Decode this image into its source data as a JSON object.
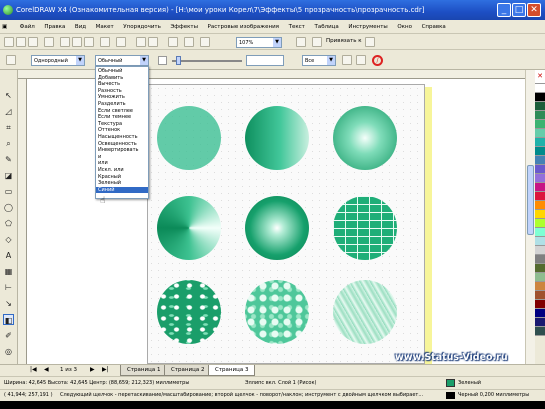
{
  "window": {
    "title": "CorelDRAW X4 (Ознакомительная версия) - [H:\\мои уроки Корел\\7\\Эффекты\\5 прозрачность\\прозрачность.cdr]",
    "buttons": {
      "minimize": "_",
      "maximize": "□",
      "close": "✕"
    }
  },
  "menu": {
    "items": [
      "Файл",
      "Правка",
      "Вид",
      "Макет",
      "Упорядочить",
      "Эффекты",
      "Растровые изображения",
      "Текст",
      "Таблица",
      "Инструменты",
      "Окно",
      "Справка"
    ],
    "window_controls": [
      "_",
      "□",
      "✕"
    ]
  },
  "toolbar1": {
    "zoom_value": "107%",
    "snap_label": "Привязать к"
  },
  "toolbar2": {
    "transparency_mode": "Однородный",
    "merge_mode": "Обычный",
    "apply_to": "Все"
  },
  "merge_mode_options": [
    "Обычный",
    "Добавить",
    "Вычесть",
    "Разность",
    "Умножить",
    "Разделить",
    "Если светлее",
    "Если темнее",
    "Текстура",
    "Оттенок",
    "Насыщенность",
    "Освещенность",
    "Инвертировать",
    "и",
    "или",
    "Искл. или",
    "Красный",
    "Зеленый",
    "Синий"
  ],
  "merge_mode_selected_index": 18,
  "colors": {
    "accent": "#1a9e6a",
    "page_border": "#f7f59a",
    "palette": [
      "#ffffff",
      "#000000",
      "#1b5e3a",
      "#2e8b57",
      "#3cb371",
      "#66cdaa",
      "#20b2aa",
      "#008b8b",
      "#4682b4",
      "#6a5acd",
      "#9370db",
      "#c71585",
      "#dc143c",
      "#ff8c00",
      "#ffd700",
      "#adff2f",
      "#7fffd4",
      "#b0e0e6",
      "#d3d3d3",
      "#808080",
      "#556b2f",
      "#8fbc8f",
      "#cd853f",
      "#a0522d",
      "#800000",
      "#000080",
      "#191970",
      "#2f4f4f"
    ]
  },
  "tabs": {
    "page_counter": "1 из 3",
    "pages": [
      "Страница 1",
      "Страница 2",
      "Страница 3"
    ]
  },
  "status": {
    "line1_left": "Ширина: 42,645  Высота: 42,645  Центр: (88,659; 212,323)  миллиметры",
    "line1_mid": "Эллипс вкл. Слой 1 (Рисок)",
    "line1_right": "Зеленый",
    "line2_left": "( 41,944; 257,191 )",
    "line2_mid": "Следующий щелчок - перетаскивание/масштабирование; второй щелчок - поворот/наклон; инструмент с двойным щелчком выбирает...",
    "line2_right": "Черный 0,200 миллиметры"
  },
  "watermark": "www.Status-Video.ru"
}
